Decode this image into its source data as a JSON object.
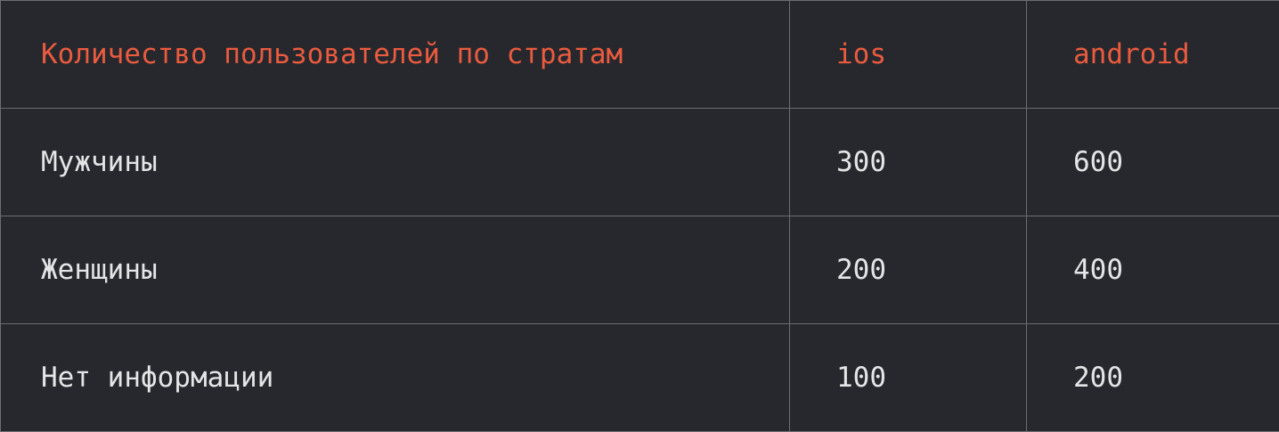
{
  "table": {
    "headers": [
      "Количество пользователей по стратам",
      "ios",
      "android"
    ],
    "rows": [
      {
        "label": "Мужчины",
        "ios": "300",
        "android": "600"
      },
      {
        "label": "Женщины",
        "ios": "200",
        "android": "400"
      },
      {
        "label": "Нет информации",
        "ios": "100",
        "android": "200"
      }
    ]
  },
  "colors": {
    "background": "#26282d",
    "header_text": "#ea5b3f",
    "body_text": "#e4e5e7",
    "grid_line": "#6b6d72"
  }
}
